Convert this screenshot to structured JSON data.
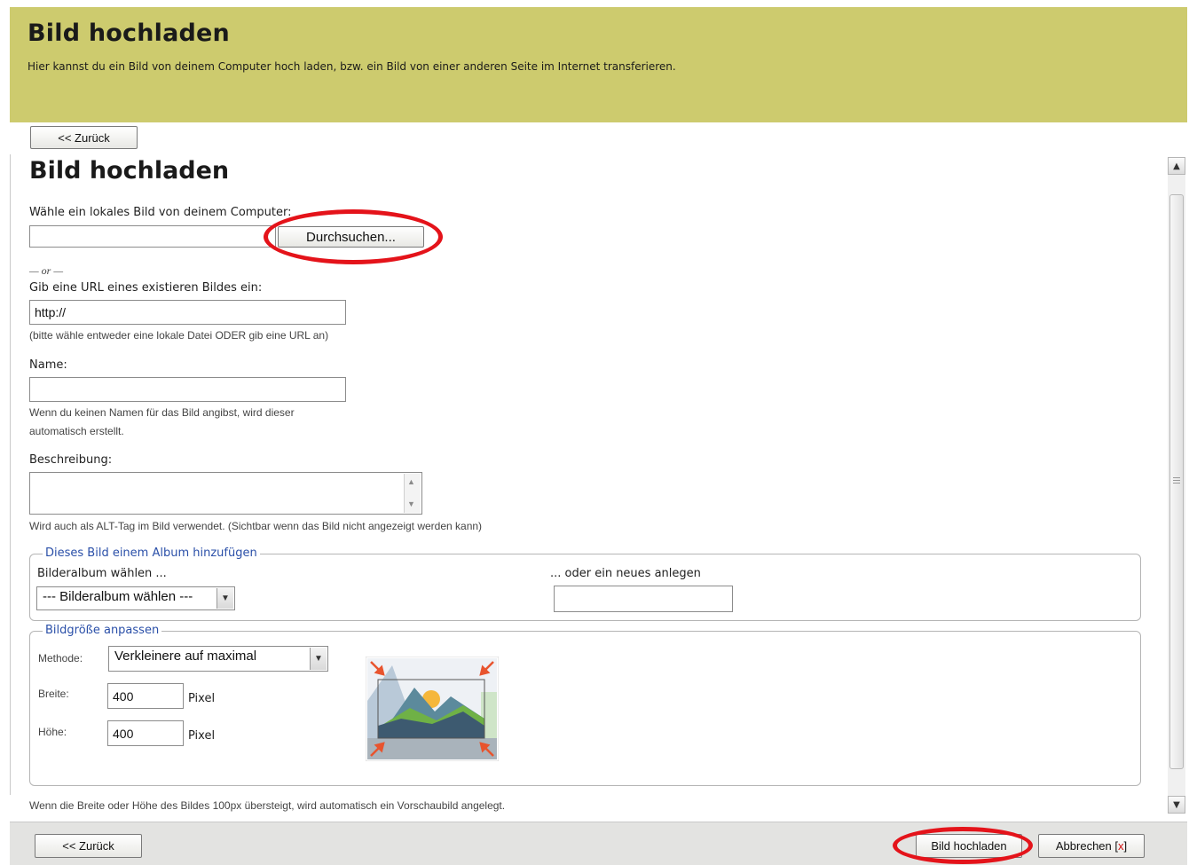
{
  "header": {
    "title": "Bild hochladen",
    "subtitle": "Hier kannst du ein Bild von deinem Computer hoch laden, bzw. ein Bild von einer anderen Seite im Internet transferieren."
  },
  "nav": {
    "back_label": "<< Zurück"
  },
  "form": {
    "title": "Bild hochladen",
    "local_label": "Wähle ein lokales Bild von deinem Computer:",
    "browse_label": "Durchsuchen...",
    "or_label": "— or —",
    "url_label": "Gib eine URL eines existieren Bildes ein:",
    "url_value": "http://",
    "url_hint": "(bitte wähle entweder eine lokale Datei ODER gib eine URL an)",
    "name_label": "Name:",
    "name_value": "",
    "name_hint_1": "Wenn du keinen Namen für das Bild angibst, wird dieser",
    "name_hint_2": "automatisch erstellt.",
    "desc_label": "Beschreibung:",
    "desc_hint": "Wird auch als ALT-Tag im Bild verwendet. (Sichtbar wenn das Bild nicht angezeigt werden kann)"
  },
  "album": {
    "legend": "Dieses Bild einem Album hinzufügen",
    "choose_label": "Bilderalbum wählen ...",
    "choose_value": "--- Bilderalbum wählen ---",
    "new_label": "... oder ein neues anlegen",
    "new_value": ""
  },
  "resize": {
    "legend": "Bildgröße anpassen",
    "method_label": "Methode:",
    "method_value": "Verkleinere auf maximal",
    "width_label": "Breite:",
    "width_value": "400",
    "height_label": "Höhe:",
    "height_value": "400",
    "unit": "Pixel",
    "preview_icon": "image-resize-icon",
    "thumbnail_hint": "Wenn die Breite oder Höhe des Bildes 100px übersteigt, wird automatisch ein Vorschaubild angelegt."
  },
  "footer": {
    "back_label": "<< Zurück",
    "upload_label": "Bild hochladen",
    "cancel_label": "Abbrechen [",
    "cancel_x": "x",
    "cancel_close": "]"
  },
  "colors": {
    "header_bg": "#cdcb6e",
    "legend_text": "#2a4fa8",
    "highlight": "#e4131a",
    "footer_bg": "#e3e3e1"
  }
}
